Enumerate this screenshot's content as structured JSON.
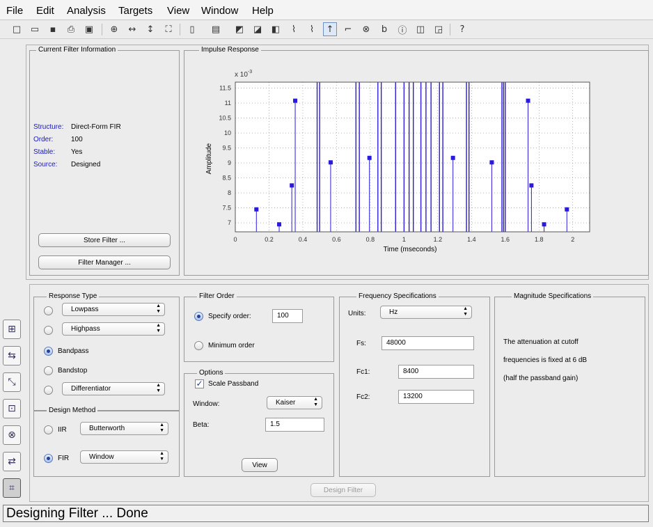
{
  "menu": [
    "File",
    "Edit",
    "Analysis",
    "Targets",
    "View",
    "Window",
    "Help"
  ],
  "toolbar_icons": [
    "new-file-icon",
    "open-folder-icon",
    "save-icon",
    "print-icon",
    "print-preview-icon",
    "zoom-in-icon",
    "zoom-x-icon",
    "zoom-y-icon",
    "full-view-icon",
    "pole-zero-editor-icon",
    "filter-specs-icon",
    "magnitude-response-icon",
    "phase-response-icon",
    "mag-phase-response-icon",
    "group-delay-icon",
    "phase-delay-icon",
    "impulse-response-icon",
    "step-response-icon",
    "pole-zero-plot-icon",
    "filter-coefficients-icon",
    "filter-information-icon",
    "magnitude-estimate-icon",
    "round-off-noise-icon",
    "whats-this-icon"
  ],
  "filter_info": {
    "title": "Current Filter Information",
    "rows": [
      {
        "key": "Structure:",
        "value": "Direct-Form FIR"
      },
      {
        "key": "Order:",
        "value": "100"
      },
      {
        "key": "Stable:",
        "value": "Yes"
      },
      {
        "key": "Source:",
        "value": "Designed"
      }
    ],
    "store_button": "Store Filter ...",
    "manager_button": "Filter Manager ..."
  },
  "chart_data": {
    "type": "stem",
    "title": "Impulse Response",
    "xlabel": "Time (mseconds)",
    "ylabel": "Amplitude",
    "exponent_label": "x 10",
    "exponent_power": "-3",
    "xlim": [
      0,
      2.1
    ],
    "ylim": [
      6.7,
      11.7
    ],
    "xticks": [
      "0",
      "0.2",
      "0.4",
      "0.6",
      "0.8",
      "1",
      "1.2",
      "1.4",
      "1.6",
      "1.8",
      "2"
    ],
    "yticks": [
      "7",
      "7.5",
      "8",
      "8.5",
      "9",
      "9.5",
      "10",
      "10.5",
      "11",
      "11.5"
    ],
    "grid": true,
    "color": "#2a1adb",
    "visible_points": [
      {
        "x": 0.125,
        "y": 7.45
      },
      {
        "x": 0.26,
        "y": 6.95
      },
      {
        "x": 0.335,
        "y": 8.25
      },
      {
        "x": 0.355,
        "y": 11.08
      },
      {
        "x": 0.565,
        "y": 9.02
      },
      {
        "x": 0.795,
        "y": 9.17
      },
      {
        "x": 1.29,
        "y": 9.17
      },
      {
        "x": 1.52,
        "y": 9.02
      },
      {
        "x": 1.735,
        "y": 11.08
      },
      {
        "x": 1.755,
        "y": 8.25
      },
      {
        "x": 1.83,
        "y": 6.95
      },
      {
        "x": 1.965,
        "y": 7.45
      }
    ],
    "offscale_stems_x": [
      0.485,
      0.5,
      0.715,
      0.735,
      0.845,
      0.865,
      0.95,
      1.0,
      1.03,
      1.055,
      1.1,
      1.13,
      1.16,
      1.21,
      1.23,
      1.37,
      1.385,
      1.58,
      1.6,
      1.59
    ]
  },
  "response_type": {
    "title": "Response Type",
    "options": [
      {
        "label": "Lowpass",
        "selected": false,
        "dropdown": true
      },
      {
        "label": "Highpass",
        "selected": false,
        "dropdown": true
      },
      {
        "label": "Bandpass",
        "selected": true,
        "dropdown": false
      },
      {
        "label": "Bandstop",
        "selected": false,
        "dropdown": false
      },
      {
        "label": "Differentiator",
        "selected": false,
        "dropdown": true
      }
    ]
  },
  "design_method": {
    "title": "Design Method",
    "iir_label": "IIR",
    "iir_value": "Butterworth",
    "fir_label": "FIR",
    "fir_value": "Window",
    "selected": "FIR"
  },
  "filter_order": {
    "title": "Filter Order",
    "specify_label": "Specify order:",
    "specify_value": "100",
    "minimum_label": "Minimum order",
    "selected": "specify"
  },
  "options": {
    "title": "Options",
    "scale_passband_label": "Scale Passband",
    "scale_passband_checked": true,
    "window_label": "Window:",
    "window_value": "Kaiser",
    "beta_label": "Beta:",
    "beta_value": "1.5",
    "view_button": "View"
  },
  "freq_specs": {
    "title": "Frequency Specifications",
    "units_label": "Units:",
    "units_value": "Hz",
    "fs_label": "Fs:",
    "fs_value": "48000",
    "fc1_label": "Fc1:",
    "fc1_value": "8400",
    "fc2_label": "Fc2:",
    "fc2_value": "13200"
  },
  "mag_specs": {
    "title": "Magnitude Specifications",
    "line1": "The attenuation at cutoff",
    "line2": "frequencies is fixed at 6 dB",
    "line3": "(half the passband gain)"
  },
  "design_button": "Design Filter",
  "status": "Designing Filter ... Done"
}
